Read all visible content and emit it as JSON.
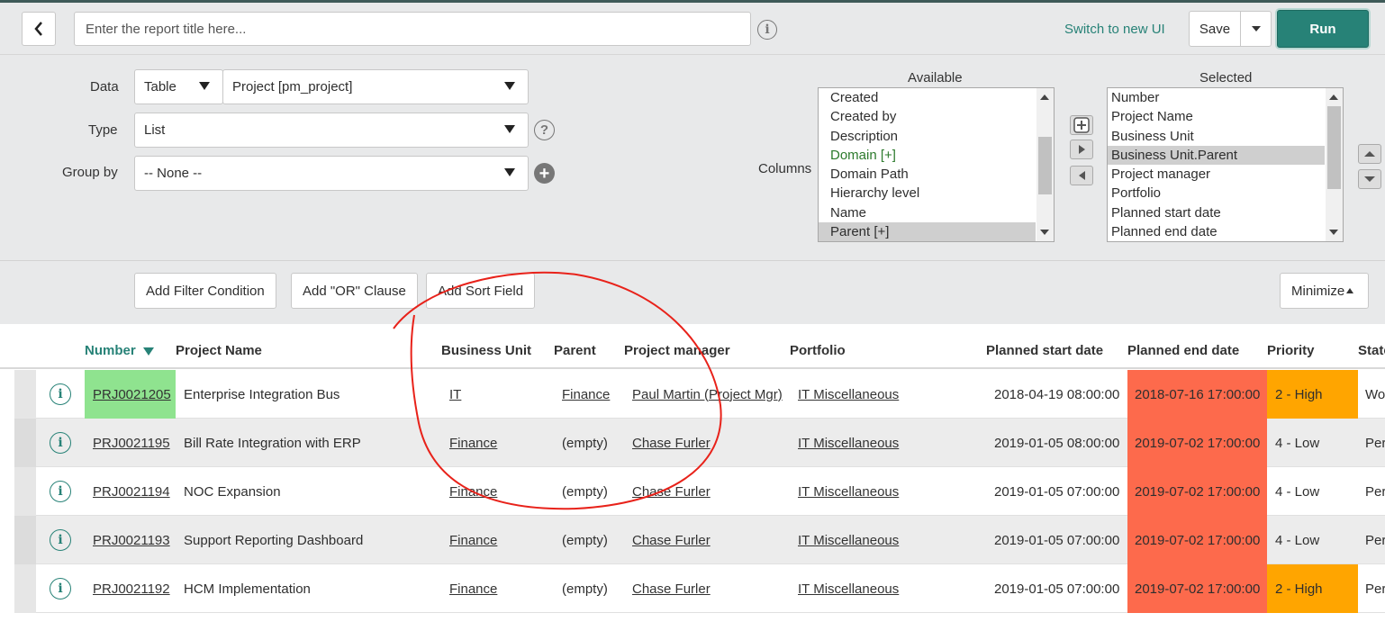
{
  "topbar": {
    "title_placeholder": "Enter the report title here...",
    "switch_ui": "Switch to new UI",
    "save": "Save",
    "run": "Run"
  },
  "config": {
    "data_label": "Data",
    "data_source_type": "Table",
    "data_table": "Project [pm_project]",
    "type_label": "Type",
    "type_value": "List",
    "group_label": "Group by",
    "group_value": "-- None --",
    "columns_label": "Columns",
    "available_title": "Available",
    "selected_title": "Selected",
    "available": [
      "Created",
      "Created by",
      "Description",
      "Domain [+]",
      "Domain Path",
      "Hierarchy level",
      "Name",
      "Parent [+]"
    ],
    "selected": [
      "Number",
      "Project Name",
      "Business Unit",
      "Business Unit.Parent",
      "Project manager",
      "Portfolio",
      "Planned start date",
      "Planned end date"
    ]
  },
  "filters": {
    "add_condition": "Add Filter Condition",
    "add_or": "Add \"OR\" Clause",
    "add_sort": "Add Sort Field",
    "minimize": "Minimize"
  },
  "table": {
    "headers": [
      "Number",
      "Project Name",
      "Business Unit",
      "Parent",
      "Project manager",
      "Portfolio",
      "Planned start date",
      "Planned end date",
      "Priority",
      "State"
    ],
    "rows": [
      {
        "number": "PRJ0021205",
        "name": "Enterprise Integration Bus",
        "bu": "IT",
        "parent": "Finance",
        "manager": "Paul Martin (Project Mgr)",
        "portfolio": "IT Miscellaneous",
        "start": "2018-04-19 08:00:00",
        "end": "2018-07-16 17:00:00",
        "priority": "2 - High",
        "state": "Wo"
      },
      {
        "number": "PRJ0021195",
        "name": "Bill Rate Integration with ERP",
        "bu": "Finance",
        "parent": "(empty)",
        "manager": "Chase Furler",
        "portfolio": "IT Miscellaneous",
        "start": "2019-01-05 08:00:00",
        "end": "2019-07-02 17:00:00",
        "priority": "4 - Low",
        "state": "Per"
      },
      {
        "number": "PRJ0021194",
        "name": "NOC Expansion",
        "bu": "Finance",
        "parent": "(empty)",
        "manager": "Chase Furler",
        "portfolio": "IT Miscellaneous",
        "start": "2019-01-05 07:00:00",
        "end": "2019-07-02 17:00:00",
        "priority": "4 - Low",
        "state": "Per"
      },
      {
        "number": "PRJ0021193",
        "name": "Support Reporting Dashboard",
        "bu": "Finance",
        "parent": "(empty)",
        "manager": "Chase Furler",
        "portfolio": "IT Miscellaneous",
        "start": "2019-01-05 07:00:00",
        "end": "2019-07-02 17:00:00",
        "priority": "4 - Low",
        "state": "Per"
      },
      {
        "number": "PRJ0021192",
        "name": "HCM Implementation",
        "bu": "Finance",
        "parent": "(empty)",
        "manager": "Chase Furler",
        "portfolio": "IT Miscellaneous",
        "start": "2019-01-05 07:00:00",
        "end": "2019-07-02 17:00:00",
        "priority": "2 - High",
        "state": "Per"
      }
    ]
  },
  "colors": {
    "accent": "#278277",
    "late_end": "#fd6a4c",
    "high_priority": "#ffa500",
    "highlight_number": "#8fe38f",
    "annotation": "#e8221a"
  }
}
